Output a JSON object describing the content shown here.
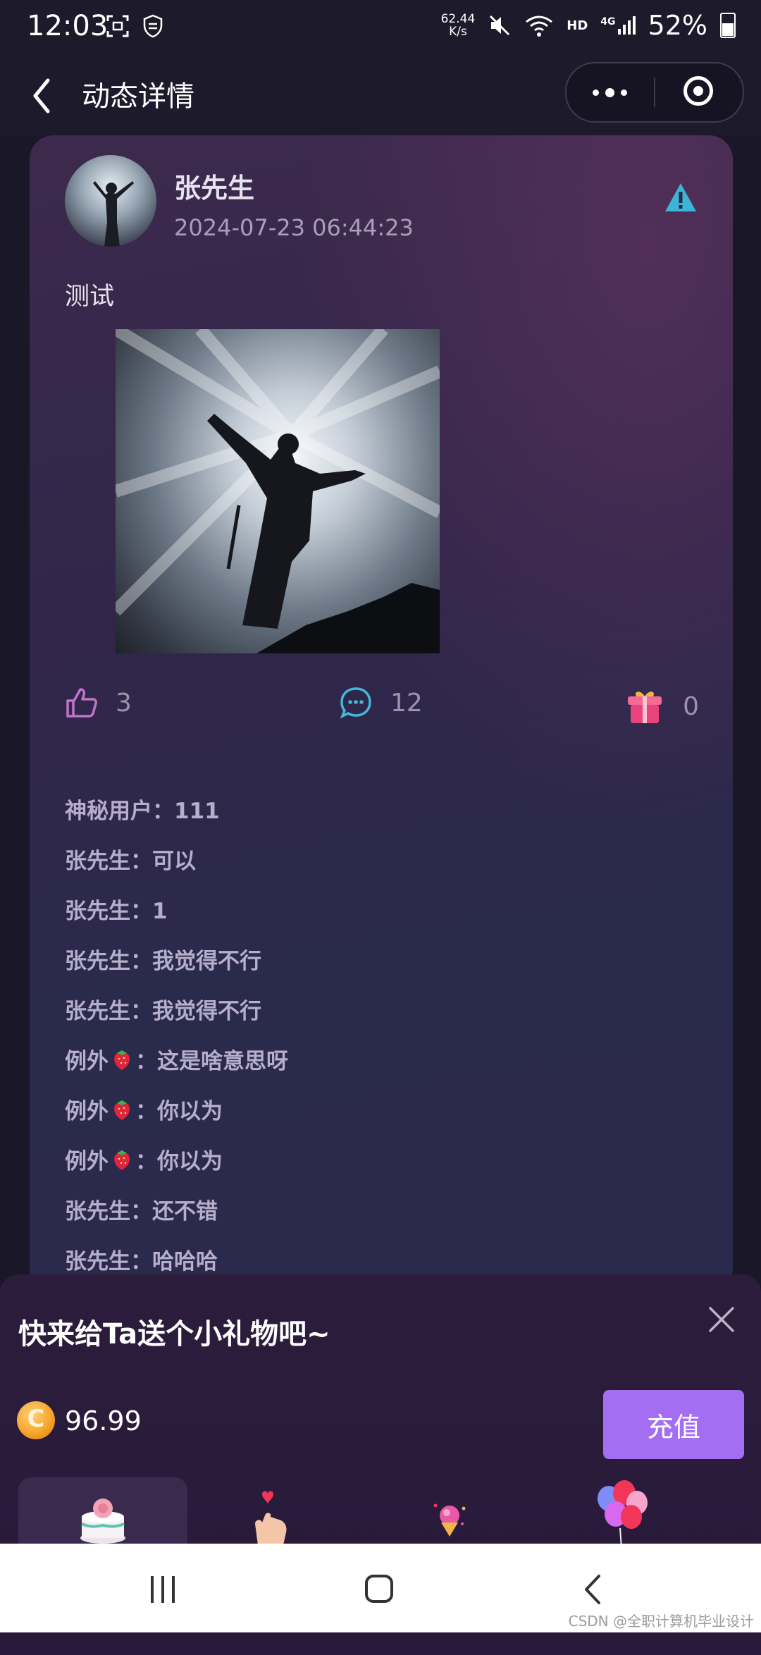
{
  "status_bar": {
    "time": "12:03",
    "net_speed_value": "62.44",
    "net_speed_unit": "K/s",
    "hd": "HD",
    "network": "4G",
    "battery": "52%"
  },
  "nav": {
    "title": "动态详情"
  },
  "post": {
    "author": "张先生",
    "time": "2024-07-23 06:44:23",
    "text": "测试",
    "likes": "3",
    "comments_count": "12",
    "gifts": "0"
  },
  "comments": [
    {
      "user": "神秘用户",
      "emoji": false,
      "text": "：111"
    },
    {
      "user": "张先生",
      "emoji": false,
      "text": "：可以"
    },
    {
      "user": "张先生",
      "emoji": false,
      "text": "：1"
    },
    {
      "user": "张先生",
      "emoji": false,
      "text": "：我觉得不行"
    },
    {
      "user": "张先生",
      "emoji": false,
      "text": "：我觉得不行"
    },
    {
      "user": "例外",
      "emoji": true,
      "text": "：这是啥意思呀"
    },
    {
      "user": "例外",
      "emoji": true,
      "text": "：你以为"
    },
    {
      "user": "例外",
      "emoji": true,
      "text": "：你以为"
    },
    {
      "user": "张先生",
      "emoji": false,
      "text": "：还不错"
    },
    {
      "user": "张先生",
      "emoji": false,
      "text": "：哈哈哈"
    }
  ],
  "gift_sheet": {
    "title": "快来给Ta送个小礼物吧~",
    "balance": "96.99",
    "recharge_label": "充值"
  },
  "watermark": "CSDN @全职计算机毕业设计",
  "colors": {
    "accent": "#a46ef2",
    "like": "#c173c8",
    "comment": "#46b6d6",
    "gift": "#e8437a"
  }
}
